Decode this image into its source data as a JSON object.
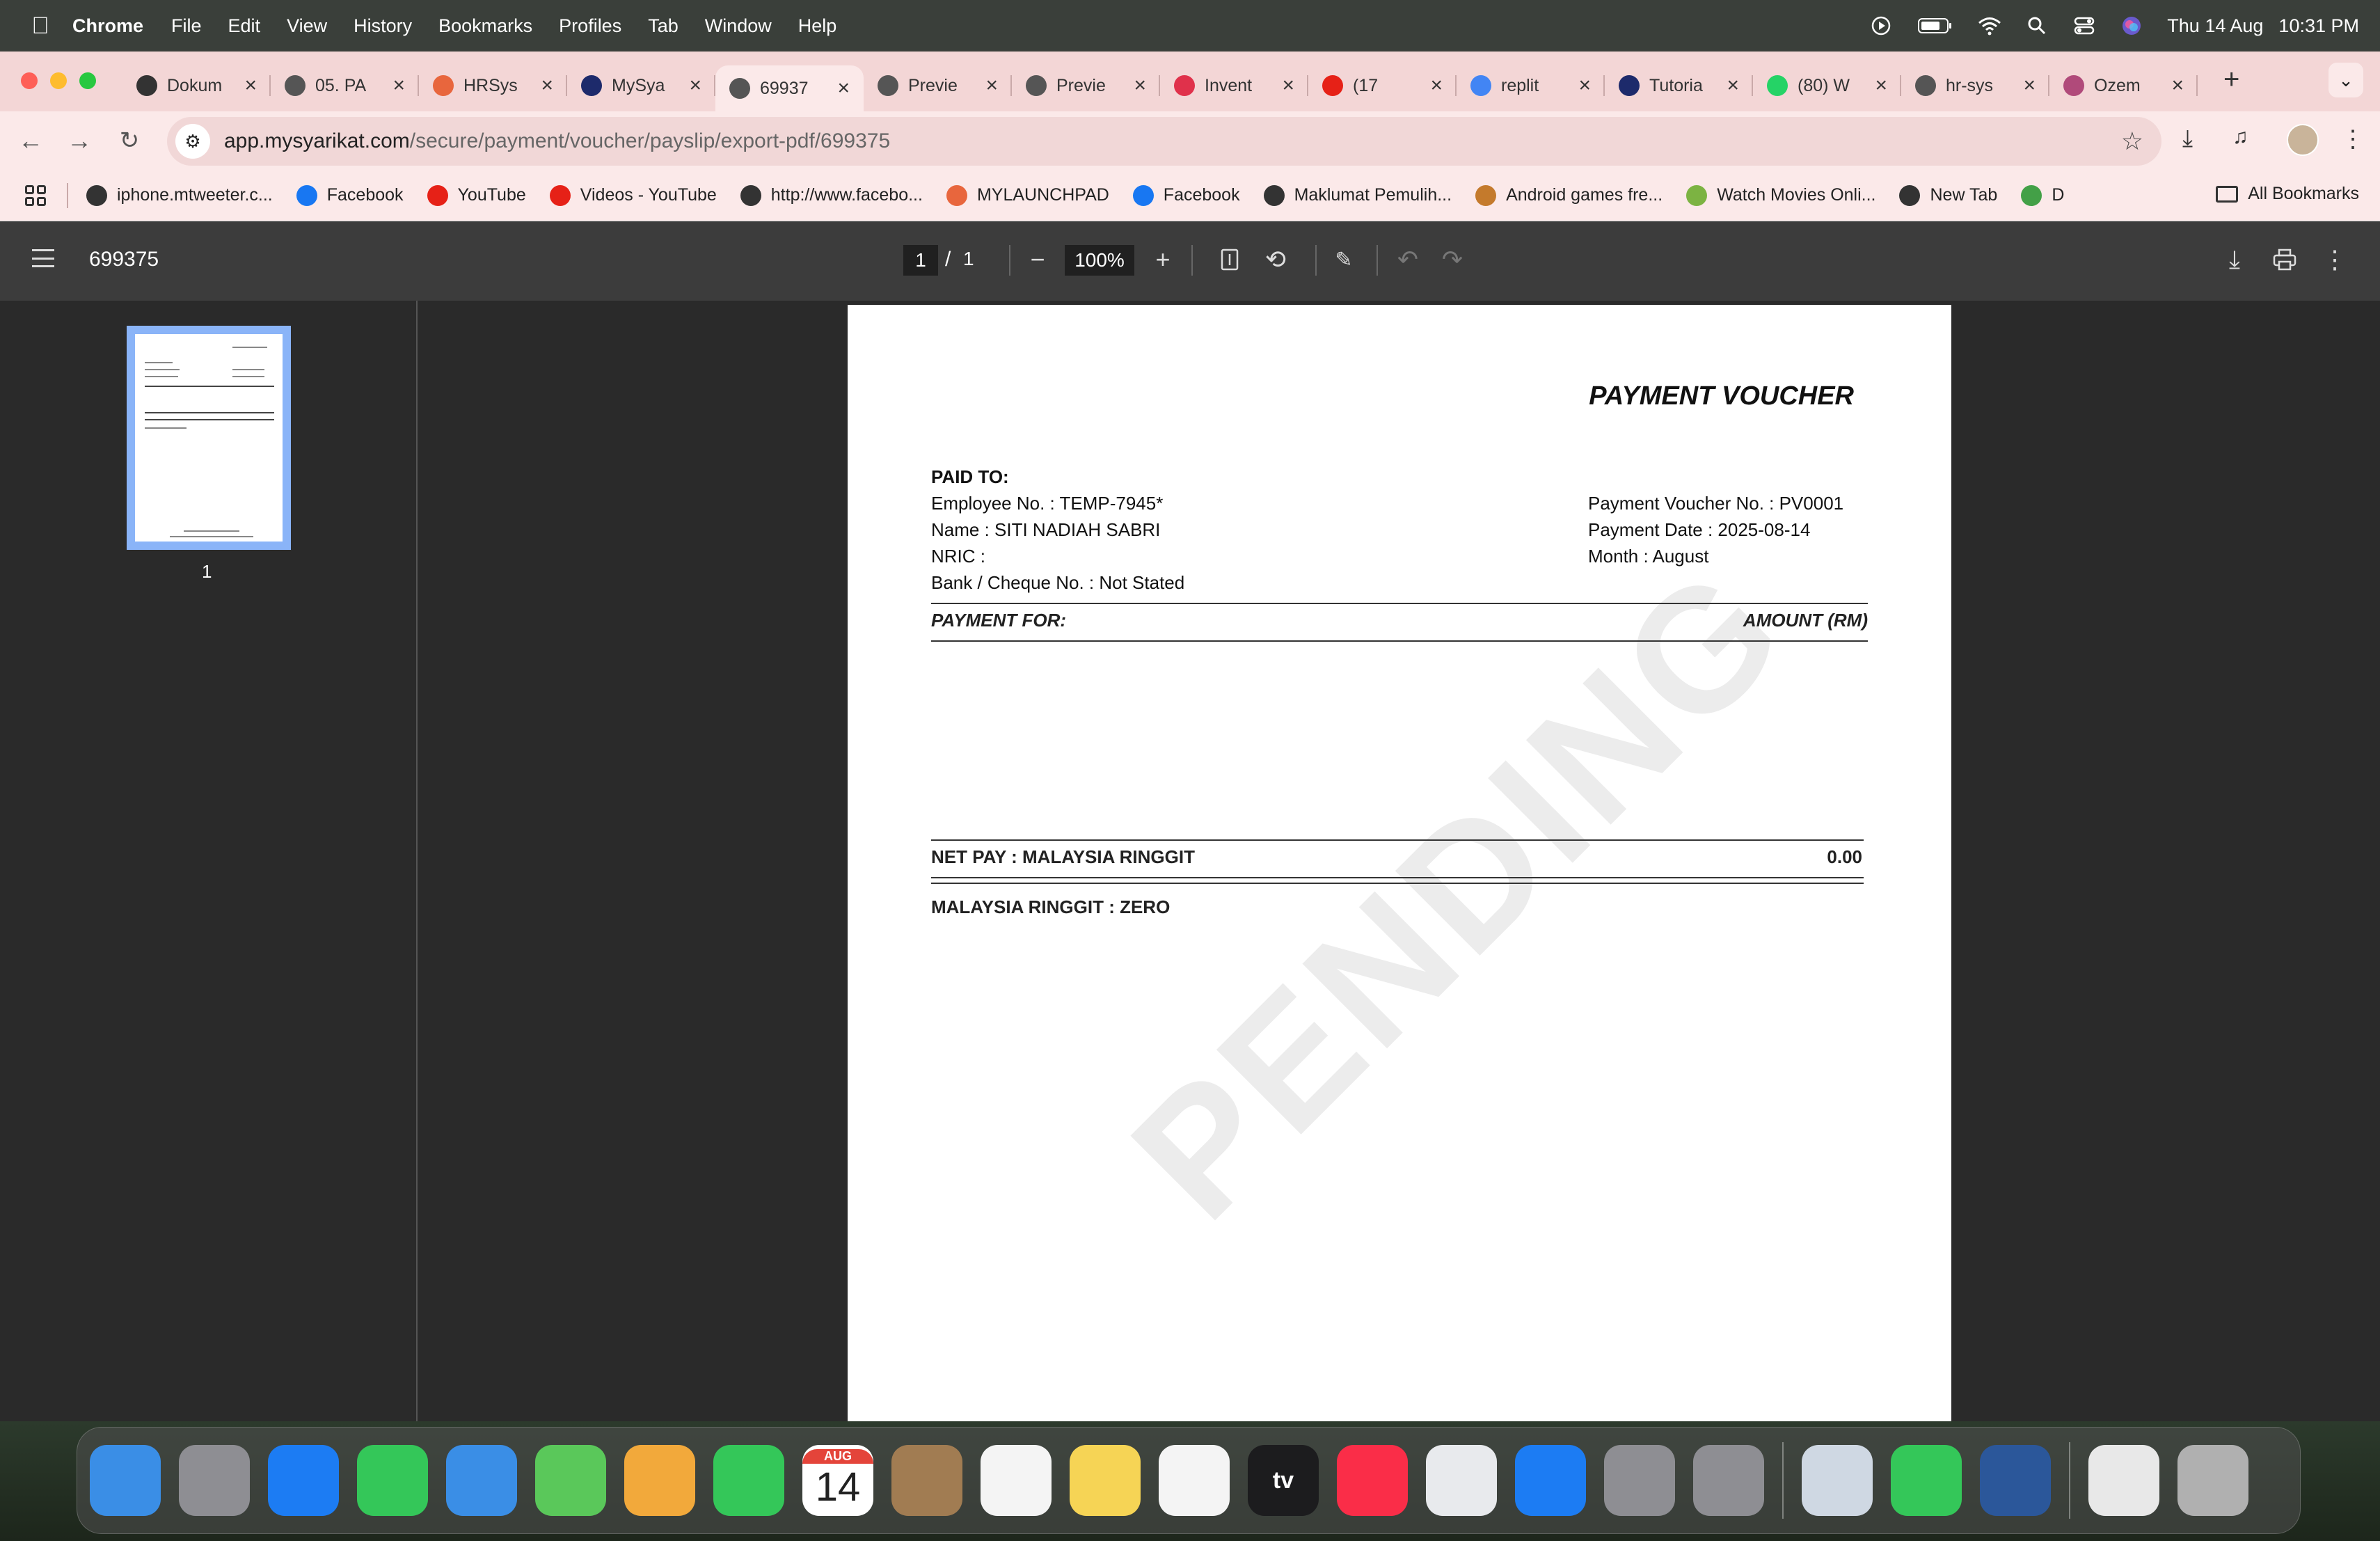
{
  "menubar": {
    "app_name": "Chrome",
    "items": [
      "File",
      "Edit",
      "View",
      "History",
      "Bookmarks",
      "Profiles",
      "Tab",
      "Window",
      "Help"
    ],
    "date": "Thu 14 Aug",
    "time": "10:31 PM"
  },
  "tabs": [
    {
      "title": "Dokum",
      "favicon": "openai-icon",
      "color": "#333333"
    },
    {
      "title": "05. PA",
      "favicon": "globe-icon",
      "color": "#555555"
    },
    {
      "title": "HRSys",
      "favicon": "hrsys-icon",
      "color": "#e8663d"
    },
    {
      "title": "MySya",
      "favicon": "mysyarikat-icon",
      "color": "#1d2a6b"
    },
    {
      "title": "69937",
      "favicon": "globe-icon",
      "color": "#555555",
      "active": true
    },
    {
      "title": "Previe",
      "favicon": "globe-icon",
      "color": "#555555"
    },
    {
      "title": "Previe",
      "favicon": "globe-icon",
      "color": "#555555"
    },
    {
      "title": "Invent",
      "favicon": "heart-icon",
      "color": "#e0314b"
    },
    {
      "title": "(17",
      "favicon": "youtube-icon",
      "color": "#e62117"
    },
    {
      "title": "replit",
      "favicon": "google-icon",
      "color": "#4285f4"
    },
    {
      "title": "Tutoria",
      "favicon": "mysyarikat-icon",
      "color": "#1d2a6b"
    },
    {
      "title": "(80) W",
      "favicon": "whatsapp-icon",
      "color": "#25d366"
    },
    {
      "title": "hr-sys",
      "favicon": "globe-icon",
      "color": "#555555"
    },
    {
      "title": "Ozem",
      "favicon": "ozem-icon",
      "color": "#b04a7a"
    }
  ],
  "address": {
    "domain": "app.mysyarikat.com",
    "path": "/secure/payment/voucher/payslip/export-pdf/699375"
  },
  "bookmarks": [
    {
      "label": "iphone.mtweeter.c...",
      "icon": "globe-icon",
      "color": "#333333"
    },
    {
      "label": "Facebook",
      "icon": "facebook-icon",
      "color": "#1877f2"
    },
    {
      "label": "YouTube",
      "icon": "youtube-icon",
      "color": "#e62117"
    },
    {
      "label": "Videos - YouTube",
      "icon": "youtube-icon",
      "color": "#e62117"
    },
    {
      "label": "http://www.facebo...",
      "icon": "globe-icon",
      "color": "#333333"
    },
    {
      "label": "MYLAUNCHPAD",
      "icon": "launchpad-icon",
      "color": "#e8663d"
    },
    {
      "label": "Facebook",
      "icon": "facebook-icon",
      "color": "#1877f2"
    },
    {
      "label": "Maklumat Pemulih...",
      "icon": "globe-icon",
      "color": "#333333"
    },
    {
      "label": "Android games fre...",
      "icon": "android-icon",
      "color": "#c47a2c"
    },
    {
      "label": "Watch Movies Onli...",
      "icon": "movie-icon",
      "color": "#7cb342"
    },
    {
      "label": "New Tab",
      "icon": "globe-icon",
      "color": "#333333"
    },
    {
      "label": "D",
      "icon": "download-icon",
      "color": "#43a047"
    }
  ],
  "all_bookmarks_label": "All Bookmarks",
  "pdf": {
    "title": "699375",
    "page_current": "1",
    "page_sep": "/",
    "page_total": "1",
    "zoom": "100%",
    "thumb_label": "1"
  },
  "voucher": {
    "heading": "PAYMENT VOUCHER",
    "paid_to_label": "PAID TO:",
    "employee_no": "Employee No. : TEMP-7945*",
    "name": "Name : SITI NADIAH SABRI",
    "nric": "NRIC :",
    "bank": "Bank / Cheque No. : Not Stated",
    "voucher_no": "Payment Voucher No. : PV0001",
    "payment_date": "Payment Date : 2025-08-14",
    "month": "Month : August",
    "payment_for_label": "PAYMENT FOR:",
    "amount_label": "AMOUNT (RM)",
    "net_pay_label": "NET PAY :  MALAYSIA RINGGIT",
    "net_pay_value": "0.00",
    "amount_words": "MALAYSIA RINGGIT : ZERO",
    "watermark": "PENDING"
  },
  "dock": {
    "calendar_month": "AUG",
    "calendar_day": "14",
    "apps": [
      {
        "name": "finder-icon",
        "color": "#3a8ee6"
      },
      {
        "name": "launchpad-icon",
        "color": "#8e8e93"
      },
      {
        "name": "safari-icon",
        "color": "#1c7cf3"
      },
      {
        "name": "messages-icon",
        "color": "#34c759"
      },
      {
        "name": "mail-icon",
        "color": "#3a8ee6"
      },
      {
        "name": "maps-icon",
        "color": "#5ac85a"
      },
      {
        "name": "photos-icon",
        "color": "#f2a93b"
      },
      {
        "name": "facetime-icon",
        "color": "#34c759"
      }
    ],
    "apps2": [
      {
        "name": "contacts-icon",
        "color": "#a17c52"
      },
      {
        "name": "reminders-icon",
        "color": "#f4f4f4"
      },
      {
        "name": "notes-icon",
        "color": "#f6d455"
      },
      {
        "name": "freeform-icon",
        "color": "#f4f4f4"
      },
      {
        "name": "tv-icon",
        "color": "#1c1c1e"
      },
      {
        "name": "music-icon",
        "color": "#fa2d48"
      },
      {
        "name": "chrome-icon",
        "color": "#e8eaed"
      },
      {
        "name": "appstore-icon",
        "color": "#1c7cf3"
      },
      {
        "name": "settings-icon",
        "color": "#8e8e93"
      },
      {
        "name": "iphone-mirroring-icon",
        "color": "#8e8e93"
      }
    ],
    "apps3": [
      {
        "name": "preview-icon",
        "color": "#cfd8e3"
      },
      {
        "name": "numbers-icon",
        "color": "#34c759"
      },
      {
        "name": "word-icon",
        "color": "#2b579a"
      }
    ],
    "apps4": [
      {
        "name": "xlsx-document-icon",
        "color": "#e8e8e8"
      },
      {
        "name": "trash-icon",
        "color": "#b0b0b0"
      }
    ],
    "tv_label": "tv"
  }
}
